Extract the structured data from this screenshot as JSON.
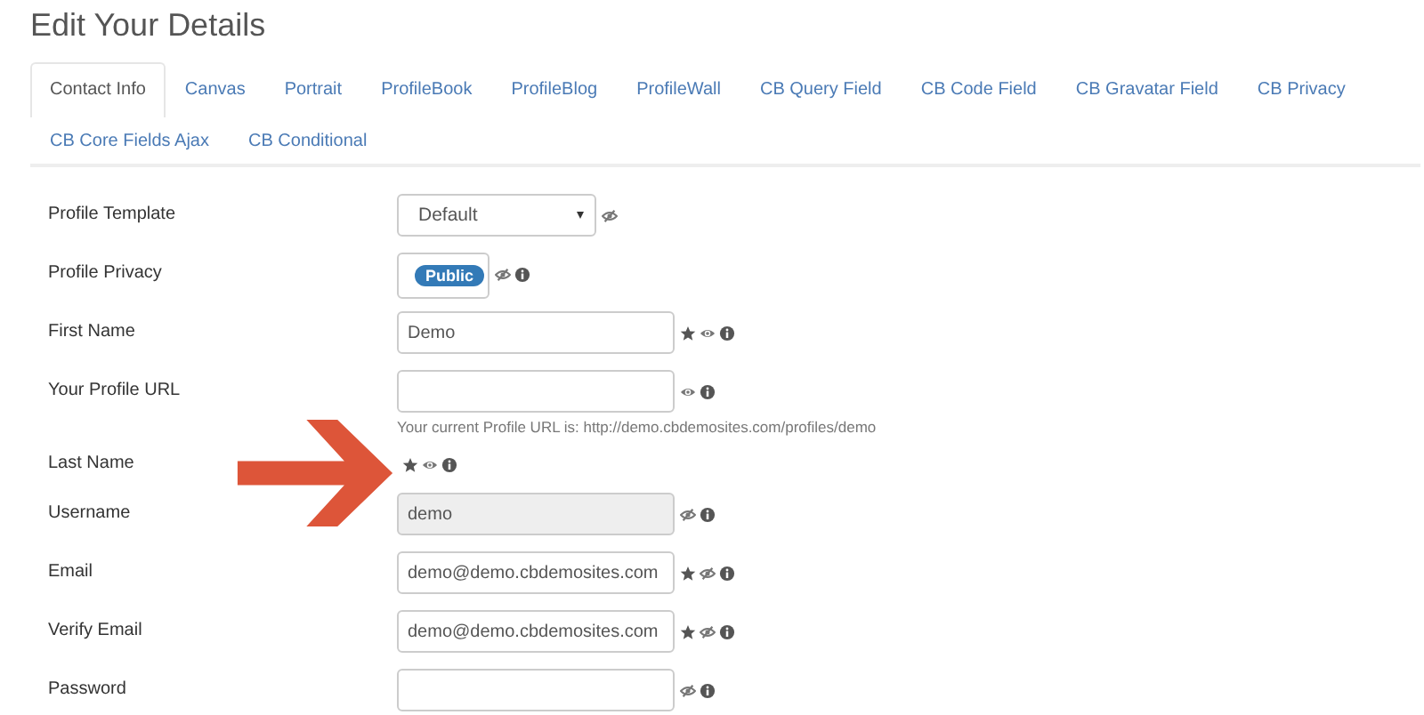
{
  "title": "Edit Your Details",
  "tabs": [
    {
      "label": "Contact Info",
      "selected": true
    },
    {
      "label": "Canvas",
      "selected": false
    },
    {
      "label": "Portrait",
      "selected": false
    },
    {
      "label": "ProfileBook",
      "selected": false
    },
    {
      "label": "ProfileBlog",
      "selected": false
    },
    {
      "label": "ProfileWall",
      "selected": false
    },
    {
      "label": "CB Query Field",
      "selected": false
    },
    {
      "label": "CB Code Field",
      "selected": false
    },
    {
      "label": "CB Gravatar Field",
      "selected": false
    },
    {
      "label": "CB Privacy",
      "selected": false
    },
    {
      "label": "CB Core Fields Ajax",
      "selected": false
    },
    {
      "label": "CB Conditional",
      "selected": false
    }
  ],
  "fields": [
    {
      "label": "Profile Template",
      "kind": "select",
      "value": "Default",
      "required": false,
      "public": false,
      "info": false
    },
    {
      "label": "Profile Privacy",
      "kind": "badge",
      "value": "Public",
      "required": false,
      "public": false,
      "info": true
    },
    {
      "label": "First Name",
      "kind": "text",
      "value": "Demo",
      "required": true,
      "public": true,
      "info": true
    },
    {
      "label": "Your Profile URL",
      "kind": "text",
      "required": false,
      "public": true,
      "info": true,
      "help": "Your current Profile URL is: http://demo.cbdemosites.com/profiles/demo"
    },
    {
      "label": "Last Name",
      "kind": "none",
      "required": true,
      "public": true,
      "info": true
    },
    {
      "label": "Username",
      "kind": "text",
      "value": "demo",
      "disabled": true,
      "required": false,
      "public": false,
      "info": true
    },
    {
      "label": "Email",
      "kind": "text",
      "value": "demo@demo.cbdemosites.com",
      "required": true,
      "public": false,
      "info": true
    },
    {
      "label": "Verify Email",
      "kind": "text",
      "value": "demo@demo.cbdemosites.com",
      "required": true,
      "public": false,
      "info": true
    },
    {
      "label": "Password",
      "kind": "text",
      "required": false,
      "public": false,
      "info": true
    }
  ],
  "callout": {
    "kind": "arrow"
  }
}
